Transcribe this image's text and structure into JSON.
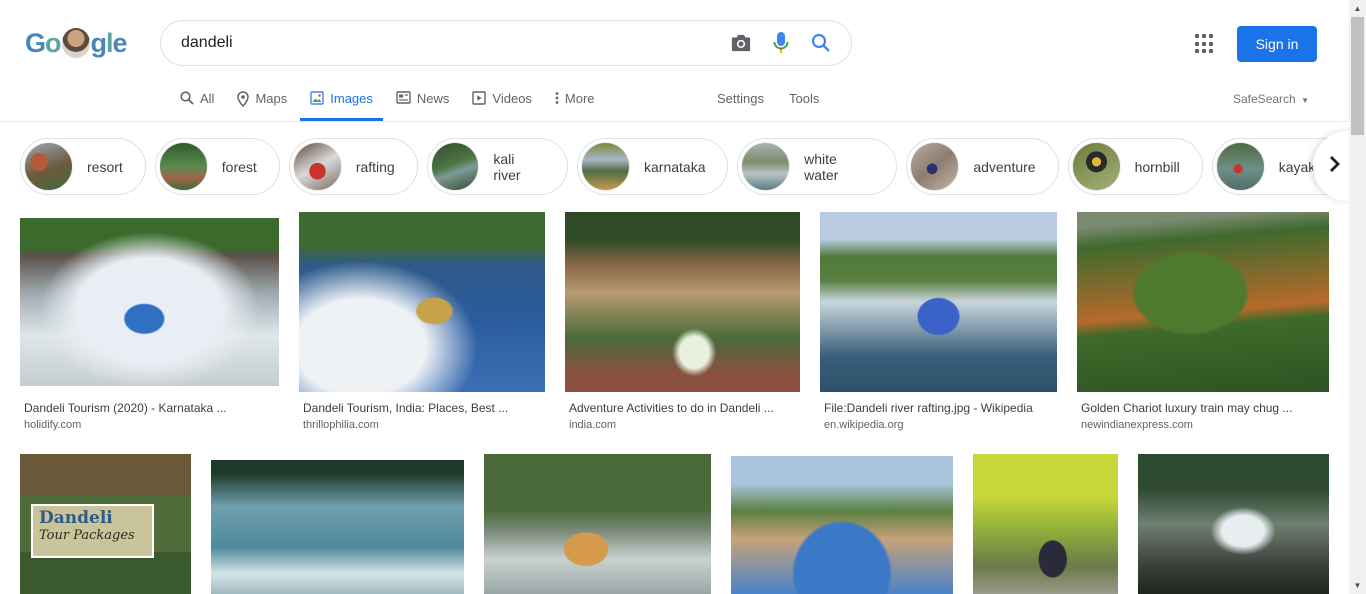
{
  "logo": {
    "letters": [
      "G",
      "o",
      "g",
      "l",
      "e"
    ]
  },
  "search": {
    "query": "dandeli"
  },
  "header": {
    "sign_in": "Sign in"
  },
  "tabs": [
    {
      "label": "All",
      "icon": "search-icon",
      "active": false
    },
    {
      "label": "Maps",
      "icon": "map-pin-icon",
      "active": false
    },
    {
      "label": "Images",
      "icon": "image-icon",
      "active": true
    },
    {
      "label": "News",
      "icon": "news-icon",
      "active": false
    },
    {
      "label": "Videos",
      "icon": "video-icon",
      "active": false
    },
    {
      "label": "More",
      "icon": "more-vert-icon",
      "active": false
    }
  ],
  "settings_label": "Settings",
  "tools_label": "Tools",
  "safesearch_label": "SafeSearch",
  "chips": [
    {
      "label": "resort",
      "color": "#7a5a3c"
    },
    {
      "label": "forest",
      "color": "#3f6b3a"
    },
    {
      "label": "rafting",
      "color": "#8a3a2e"
    },
    {
      "label": "kali river",
      "color": "#355a37"
    },
    {
      "label": "karnataka",
      "color": "#4f6d45"
    },
    {
      "label": "white water",
      "color": "#6b7d7a"
    },
    {
      "label": "adventure",
      "color": "#8b7d70"
    },
    {
      "label": "hornbill",
      "color": "#6d7b3a"
    },
    {
      "label": "kayaking",
      "color": "#5f7a74"
    }
  ],
  "results_row1": [
    {
      "title": "Dandeli Tourism (2020) - Karnataka ...",
      "site": "holidify.com"
    },
    {
      "title": "Dandeli Tourism, India: Places, Best ...",
      "site": "thrillophilia.com"
    },
    {
      "title": "Adventure Activities to do in Dandeli ...",
      "site": "india.com"
    },
    {
      "title": "File:Dandeli river rafting.jpg - Wikipedia",
      "site": "en.wikipedia.org"
    },
    {
      "title": "Golden Chariot luxury train may chug ...",
      "site": "newindianexpress.com"
    }
  ],
  "image_overlay": {
    "line1": "Dandeli",
    "line2": "Tour Packages"
  },
  "colors": {
    "accent": "#1a73e8",
    "text": "#202124",
    "muted": "#5f6368"
  }
}
